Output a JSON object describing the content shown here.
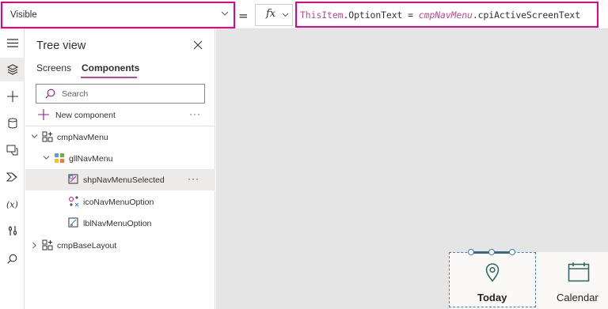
{
  "formula_bar": {
    "property": "Visible",
    "equals": "=",
    "fx_label": "fx",
    "formula": {
      "this_item": "ThisItem",
      "rest": ".OptionText = ",
      "ref": "cmpNavMenu",
      "tail": ".cpiActiveScreenText"
    },
    "highlight_color": "#e3008c"
  },
  "rail": {
    "items": [
      {
        "icon": "hamburger-menu-icon"
      },
      {
        "icon": "layers-icon",
        "active": true
      },
      {
        "icon": "plus-icon"
      },
      {
        "icon": "database-icon"
      },
      {
        "icon": "media-icon"
      },
      {
        "icon": "power-automate-icon"
      },
      {
        "icon": "variables-icon"
      },
      {
        "icon": "tools-icon"
      },
      {
        "icon": "search-icon"
      }
    ]
  },
  "tree_view": {
    "title": "Tree view",
    "tabs": [
      {
        "label": "Screens"
      },
      {
        "label": "Components",
        "active": true
      }
    ],
    "search_placeholder": "Search",
    "new_component_label": "New component",
    "more": "···",
    "nodes": [
      {
        "label": "cmpNavMenu",
        "icon": "component-icon",
        "expanded": true
      },
      {
        "label": "gllNavMenu",
        "icon": "gallery-icon",
        "expanded": true
      },
      {
        "label": "shpNavMenuSelected",
        "icon": "shape-icon",
        "selected": true
      },
      {
        "label": "icoNavMenuOption",
        "icon": "icon-control-icon"
      },
      {
        "label": "lblNavMenuOption",
        "icon": "label-control-icon"
      },
      {
        "label": "cmpBaseLayout",
        "icon": "component-icon",
        "expanded": false
      }
    ]
  },
  "canvas": {
    "nav_items": [
      {
        "label": "Today",
        "icon": "location-pin-icon",
        "selected": true
      },
      {
        "label": "Calendar",
        "icon": "calendar-icon"
      }
    ],
    "accent": "#2f6b5e"
  }
}
